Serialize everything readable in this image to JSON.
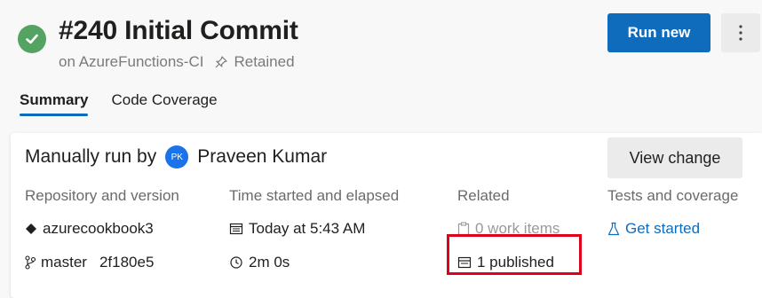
{
  "header": {
    "title": "#240 Initial Commit",
    "subtitle_pipeline": "on AzureFunctions-CI",
    "subtitle_retained": "Retained",
    "run_new_label": "Run new",
    "more_label": "⋮"
  },
  "tabs": [
    {
      "label": "Summary",
      "active": true
    },
    {
      "label": "Code Coverage",
      "active": false
    }
  ],
  "summary": {
    "manual_run_label": "Manually run by",
    "avatar_initials": "PK",
    "user_name": "Praveen Kumar",
    "view_change_label": "View change",
    "columns": {
      "repo_header": "Repository and version",
      "time_header": "Time started and elapsed",
      "related_header": "Related",
      "tests_header": "Tests and coverage"
    },
    "repo_name": "azurecookbook3",
    "branch": "master",
    "commit": "2f180e5",
    "started": "Today at 5:43 AM",
    "elapsed": "2m 0s",
    "work_items": "0 work items",
    "published": "1 published",
    "get_started": "Get started"
  },
  "colors": {
    "accent": "#0f6cbd",
    "success": "#55a362",
    "highlight": "#e0001b"
  }
}
